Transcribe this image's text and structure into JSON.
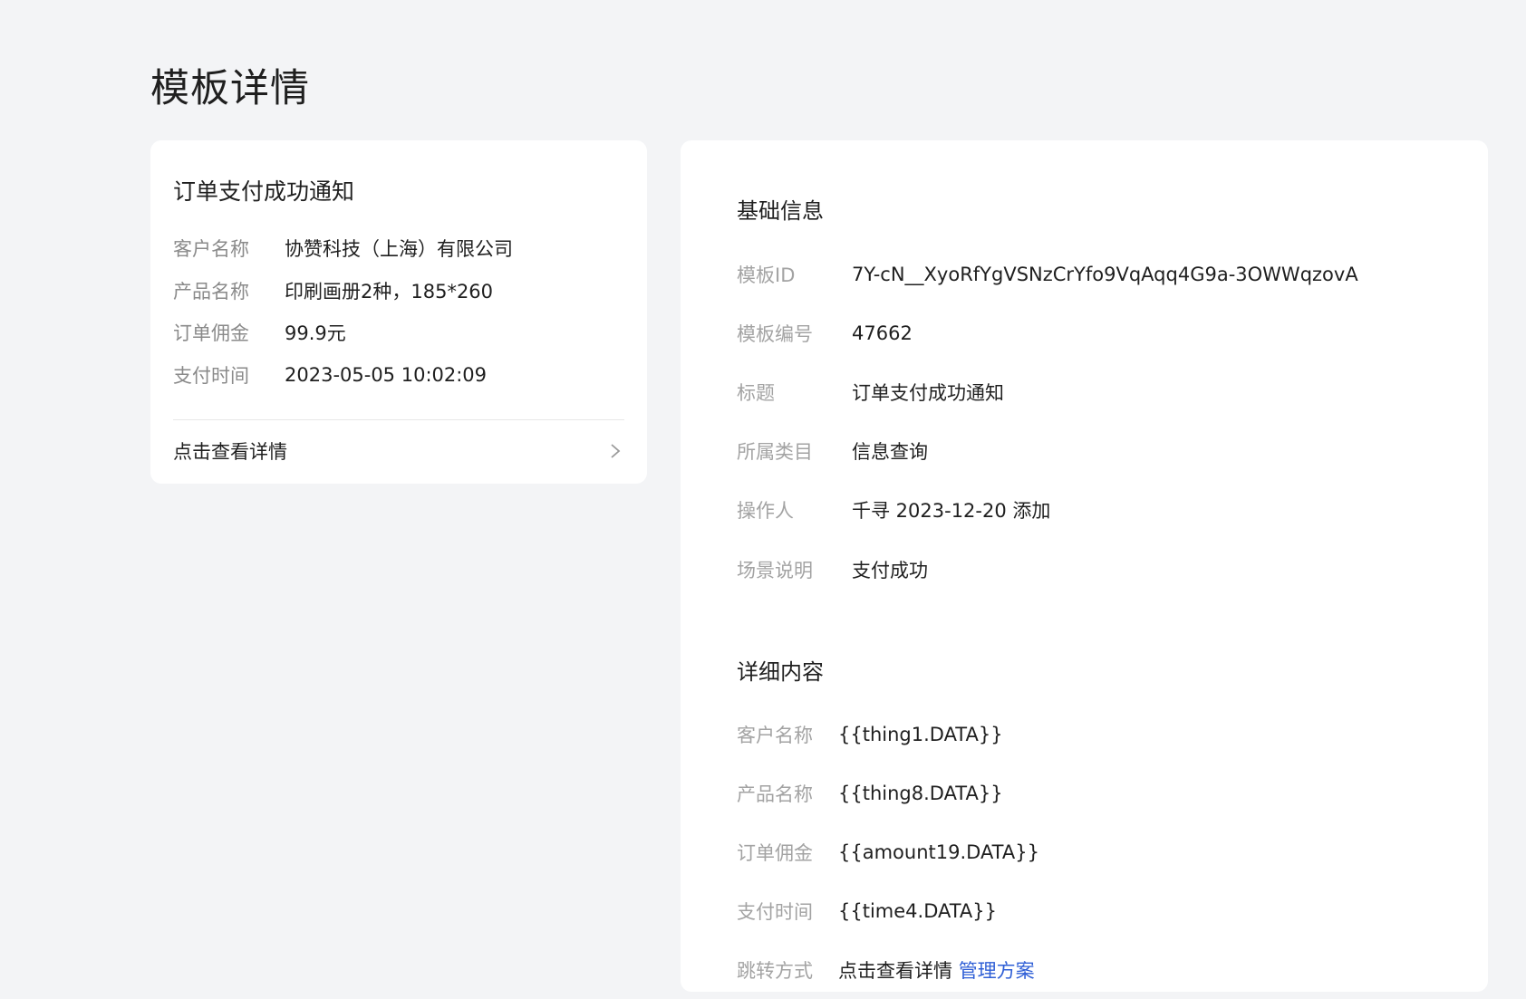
{
  "page": {
    "title": "模板详情"
  },
  "preview": {
    "title": "订单支付成功通知",
    "rows": [
      {
        "label": "客户名称",
        "value": "协赞科技（上海）有限公司"
      },
      {
        "label": "产品名称",
        "value": "印刷画册2种，185*260"
      },
      {
        "label": "订单佣金",
        "value": "99.9元"
      },
      {
        "label": "支付时间",
        "value": "2023-05-05 10:02:09"
      }
    ],
    "link_label": "点击查看详情",
    "link_icon": "chevron-right-icon"
  },
  "basic": {
    "title": "基础信息",
    "rows": [
      {
        "label": "模板ID",
        "value": "7Y-cN__XyoRfYgVSNzCrYfo9VqAqq4G9a-3OWWqzovA"
      },
      {
        "label": "模板编号",
        "value": "47662"
      },
      {
        "label": "标题",
        "value": "订单支付成功通知"
      },
      {
        "label": "所属类目",
        "value": "信息查询"
      },
      {
        "label": "操作人",
        "value": "千寻 2023-12-20 添加"
      },
      {
        "label": "场景说明",
        "value": "支付成功"
      }
    ]
  },
  "detail": {
    "title": "详细内容",
    "rows": [
      {
        "label": "客户名称",
        "value": "{{thing1.DATA}}"
      },
      {
        "label": "产品名称",
        "value": "{{thing8.DATA}}"
      },
      {
        "label": "订单佣金",
        "value": "{{amount19.DATA}}"
      },
      {
        "label": "支付时间",
        "value": "{{time4.DATA}}"
      }
    ],
    "partial_row": {
      "label": "跳转方式",
      "value": "点击查看详情",
      "link": "管理方案"
    }
  },
  "colors": {
    "background": "#f3f4f6",
    "card": "#ffffff",
    "label": "#a3a3a3",
    "text": "#1f1f1f",
    "link": "#2f5fd6"
  }
}
